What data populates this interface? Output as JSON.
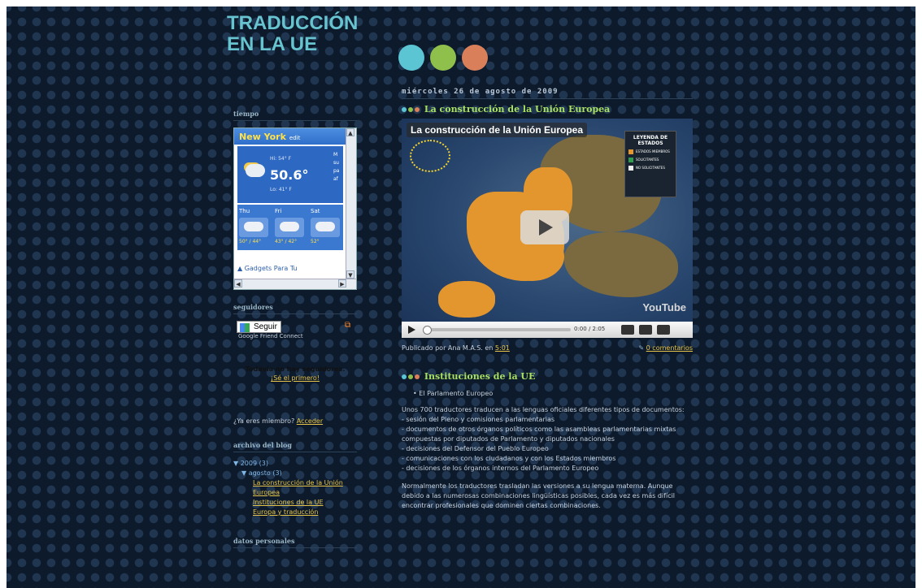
{
  "blog": {
    "title_line1": "TRADUCCIÓN",
    "title_line2": "EN LA UE",
    "colors": {
      "cyan": "#5bc5d3",
      "green": "#8fc04b",
      "salmon": "#d9805b",
      "link": "#e7c54a",
      "title": "#67c3cf"
    }
  },
  "sidebar": {
    "weather": {
      "title": "tiempo",
      "city": "New York",
      "edit": "edit",
      "temp": "50.6°",
      "hi": "Hi: 54° F",
      "lo": "Lo: 41° F",
      "side_text": "M su pa af",
      "days": [
        {
          "name": "Thu",
          "temps": "50° / 44°"
        },
        {
          "name": "Fri",
          "temps": "43° / 42°"
        },
        {
          "name": "Sat",
          "temps": "52°"
        }
      ],
      "footer": "Gadgets Para Tu"
    },
    "followers": {
      "title": "seguidores",
      "follow_button": "Seguir",
      "gfc": "Google Friend Connect",
      "no_followers": "Todavía no hay seguidores.",
      "be_first": "¡Sé el primero!",
      "already_member": "¿Ya eres miembro?",
      "login": "Acceder"
    },
    "archive": {
      "title": "archivo del blog",
      "year": "2009 (3)",
      "month": "agosto (3)",
      "posts": [
        "La construcción de la Unión Europea",
        "Instituciones de la UE",
        "Europa y traducción"
      ]
    },
    "profile_title": "datos personales"
  },
  "main": {
    "date": "miércoles 26 de agosto de 2009",
    "post1": {
      "title": "La construcción de la Unión Europea",
      "video_title": "La construcción de la Unión Europea",
      "legend_title": "LEYENDA DE ESTADOS",
      "legend_items": [
        "ESTADOS MIEMBROS",
        "SOLICITANTES",
        "NO SOLICITANTES"
      ],
      "time": "0:00 / 2:05",
      "youtube": "YouTube",
      "published_by": "Publicado por Ana M.A.S. en",
      "time_link": "5:01",
      "comments": "0 comentarios"
    },
    "post2": {
      "title": "Instituciones de la UE",
      "bullet": "El Parlamento Europeo",
      "paragraph1": "Unos 700 traductores traducen a las lenguas oficiales diferentes tipos de documentos:\n- sesión del Pleno y comisiones parlamentarias\n- documentos de otros órganos políticos como las asambleas parlamentarias mixtas compuestas por diputados de Parlamento y diputados nacionales\n- decisiones del Defensor del Pueblo Europeo\n- comunicaciones con los ciudadanos y con los Estados miembros\n- decisiones de los órganos internos del Parlamento Europeo",
      "paragraph2": "Normalmente los traductores trasladan las versiones a su lengua materna. Aunque debido a las numerosas combinaciones lingüísticas posibles, cada vez es más difícil encontrar profesionales que dominen ciertas combinaciones."
    }
  }
}
